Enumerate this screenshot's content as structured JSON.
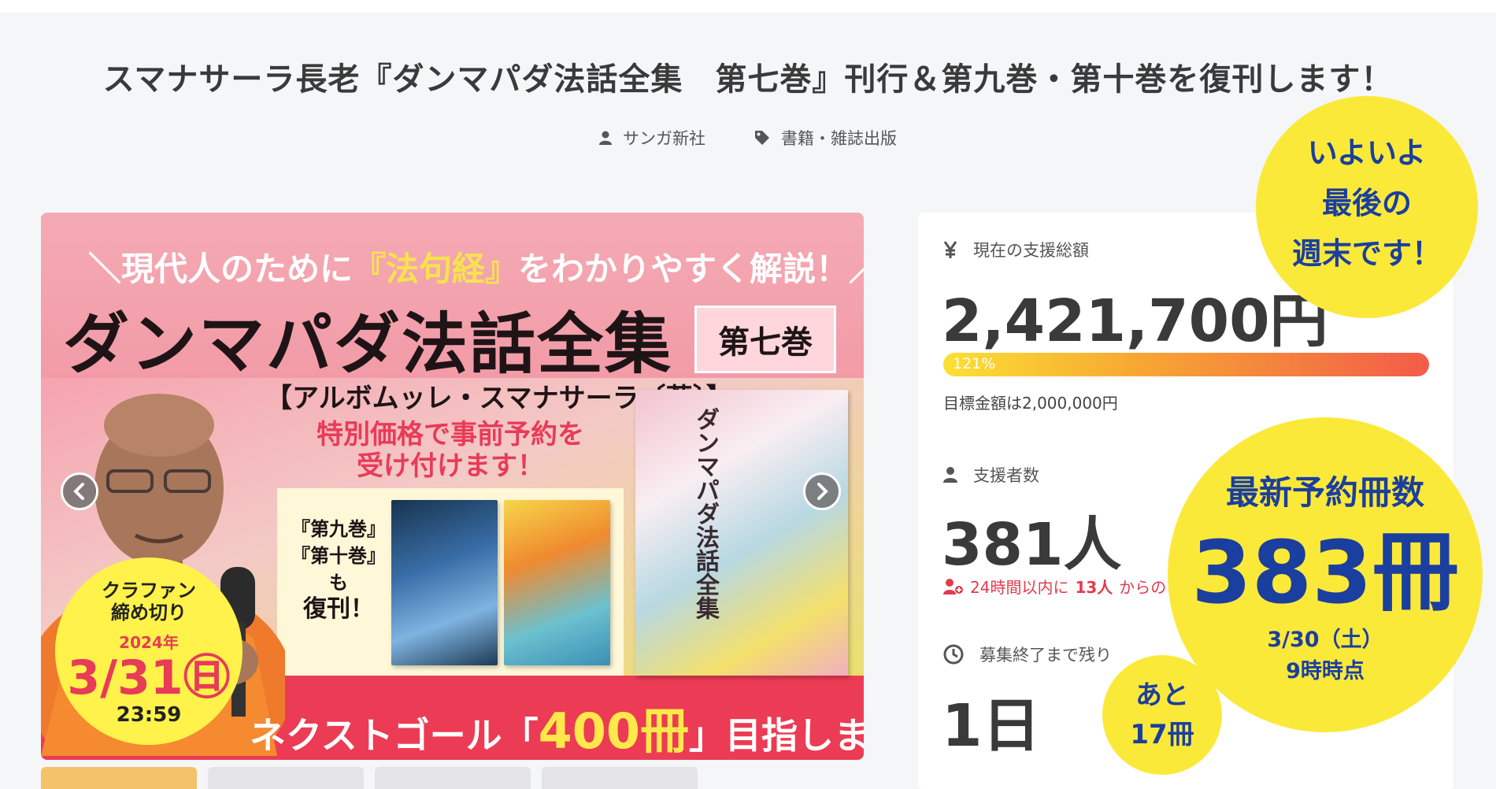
{
  "page": {
    "title": "スマナサーラ長老『ダンマパダ法話全集　第七巻』刊行＆第九巻・第十巻を復刊します！",
    "author": "サンガ新社",
    "category": "書籍・雑誌出版"
  },
  "hero": {
    "tagline_pre": "＼現代人のために",
    "tagline_highlight": "『法句経』",
    "tagline_post": "をわかりやすく解説！／",
    "main_title": "ダンマパダ法話全集",
    "volume": "第七巻",
    "author_line": "【アルボムッレ・スマナサーラ〔著〕】",
    "preorder_line1": "特別価格で事前予約を",
    "preorder_line2": "受け付けます！",
    "reprint_line1": "『第九巻』",
    "reprint_line2": "『第十巻』も",
    "reprint_line3": "復刊！",
    "book_spine_title": "ダンマパダ法話全集",
    "deadline_label1": "クラファン",
    "deadline_label2": "締め切り",
    "deadline_year": "2024年",
    "deadline_date": "3/31㊐",
    "deadline_time": "23:59",
    "next_goal_pre": "ネクストゴール「",
    "next_goal_num": "400冊",
    "next_goal_post": "」目指します！"
  },
  "stats": {
    "total_label": "現在の支援総額",
    "total_value": "2,421,700円",
    "progress_percent": 121,
    "progress_label": "121%",
    "goal_text": "目標金額は2,000,000円",
    "supporters_label": "支援者数",
    "supporters_value": "381人",
    "recent_pre": "24時間以内に",
    "recent_count": "13人",
    "recent_post": "からの",
    "remaining_label": "募集終了まで残り",
    "remaining_value": "1日"
  },
  "overlays": {
    "weekend_line1": "いよいよ",
    "weekend_line2": "最後の",
    "weekend_line3": "週末です！",
    "latest_label": "最新予約冊数",
    "latest_value": "383冊",
    "latest_date": "3/30（土）",
    "latest_time": "9時時点",
    "remain_line1": "あと",
    "remain_line2": "17冊"
  },
  "colors": {
    "circle_yellow": "#fbe93a",
    "circle_text_blue": "#1b3f9e",
    "hero_pink": "#f1a3ad",
    "hero_red": "#ec3b54",
    "accent_red": "#e23b4e"
  },
  "icons": [
    "user-icon",
    "tag-icon",
    "yen-icon",
    "supporters-icon",
    "recent-supporters-icon",
    "clock-icon",
    "chevron-left-icon",
    "chevron-right-icon"
  ]
}
